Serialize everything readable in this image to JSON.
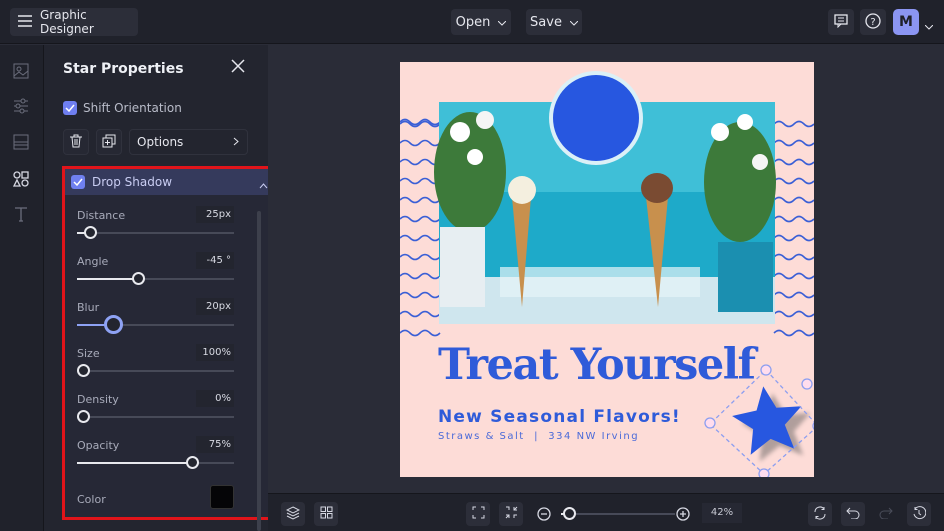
{
  "app": {
    "title": "Graphic Designer",
    "avatar_initial": "M"
  },
  "toolbar": {
    "open_label": "Open",
    "save_label": "Save"
  },
  "panel": {
    "title": "Star Properties",
    "shift_orientation": {
      "label": "Shift Orientation",
      "checked": true
    },
    "options_label": "Options",
    "drop_shadow": {
      "label": "Drop Shadow",
      "checked": true,
      "sliders": [
        {
          "label": "Distance",
          "value": "25px",
          "fraction": 0.08
        },
        {
          "label": "Angle",
          "value": "-45 °",
          "fraction": 0.39
        },
        {
          "label": "Blur",
          "value": "20px",
          "fraction": 0.23
        },
        {
          "label": "Size",
          "value": "100%",
          "fraction": 0.0
        },
        {
          "label": "Density",
          "value": "0%",
          "fraction": 0.0
        },
        {
          "label": "Opacity",
          "value": "75%",
          "fraction": 0.73
        }
      ],
      "color_label": "Color",
      "color": "#050507"
    }
  },
  "design": {
    "headline": "Treat Yourself",
    "subheadline": "New Seasonal Flavors!",
    "tagline": "Straws & Salt  |  334 NW Irving",
    "brand_color": "#2f5bd9",
    "background": "#fddcd7"
  },
  "bottom": {
    "zoom_value": "42%",
    "zoom_fraction": 0.07
  }
}
